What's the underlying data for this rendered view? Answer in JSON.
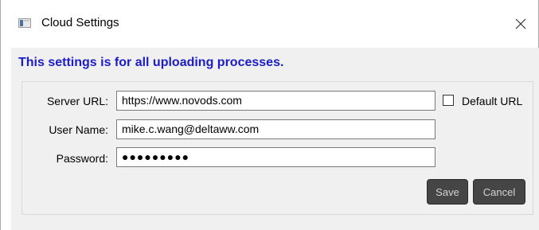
{
  "window": {
    "title": "Cloud Settings",
    "icon": "window-app-icon",
    "close_icon": "close-icon"
  },
  "heading": "This settings is for all uploading processes.",
  "form": {
    "server_url": {
      "label": "Server URL:",
      "value": "https://www.novods.com"
    },
    "default_url": {
      "label": "Default URL",
      "checked": false
    },
    "user_name": {
      "label": "User Name:",
      "value": "mike.c.wang@deltaww.com"
    },
    "password": {
      "label": "Password:",
      "value": "●●●●●●●●●"
    }
  },
  "buttons": {
    "save": "Save",
    "cancel": "Cancel"
  },
  "colors": {
    "heading": "#1c1cc8",
    "button_bg": "#454545",
    "button_text": "#d4d4d4",
    "content_bg": "#f0f0f0"
  }
}
